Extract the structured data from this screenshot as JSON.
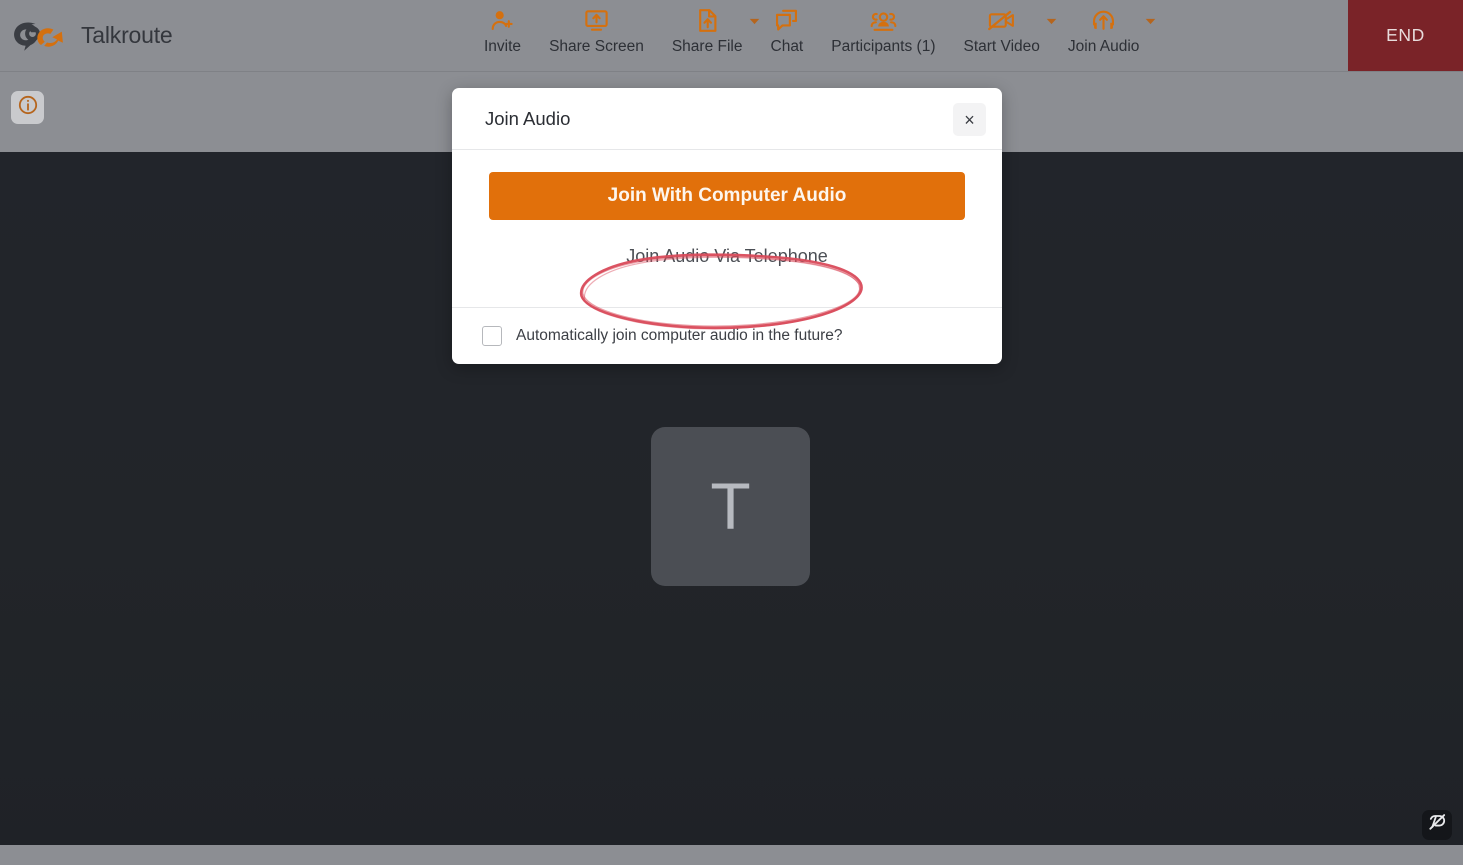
{
  "app": {
    "brand_name": "Talkroute",
    "brand_logo_icon": "talkroute-swoosh-logo",
    "accent_color": "#d4700f",
    "toolbar_bg": "#8c8e93",
    "stage_bg": "#22252b",
    "end_button_bg": "#7a2328",
    "primary_button_color": "#e1700b",
    "annotation_color": "#d94a5a"
  },
  "toolbar": {
    "items": [
      {
        "label": "Invite",
        "icon": "person-add-icon",
        "caret": false
      },
      {
        "label": "Share Screen",
        "icon": "share-screen-icon",
        "caret": false
      },
      {
        "label": "Share File",
        "icon": "share-file-icon",
        "caret": true
      },
      {
        "label": "Chat",
        "icon": "chat-bubbles-icon",
        "caret": false
      },
      {
        "label": "Participants (1)",
        "icon": "participants-icon",
        "caret": false
      },
      {
        "label": "Start Video",
        "icon": "video-off-icon",
        "caret": true
      },
      {
        "label": "Join Audio",
        "icon": "headphones-up-icon",
        "caret": true
      }
    ],
    "end_label": "END"
  },
  "stage": {
    "info_icon": "info-circle-icon",
    "avatar_initial": "T",
    "corner_indicator_icon": "share-screen-off-icon"
  },
  "modal": {
    "title": "Join Audio",
    "close_icon": "close-icon",
    "close_label": "×",
    "primary_button": "Join With Computer Audio",
    "secondary_button": "Join Audio Via Telephone",
    "checkbox_label": "Automatically join computer audio in the future?",
    "checkbox_checked": false
  },
  "annotation": {
    "shape": "hand-drawn-red-ellipse",
    "targets": "Join Audio Via Telephone"
  }
}
